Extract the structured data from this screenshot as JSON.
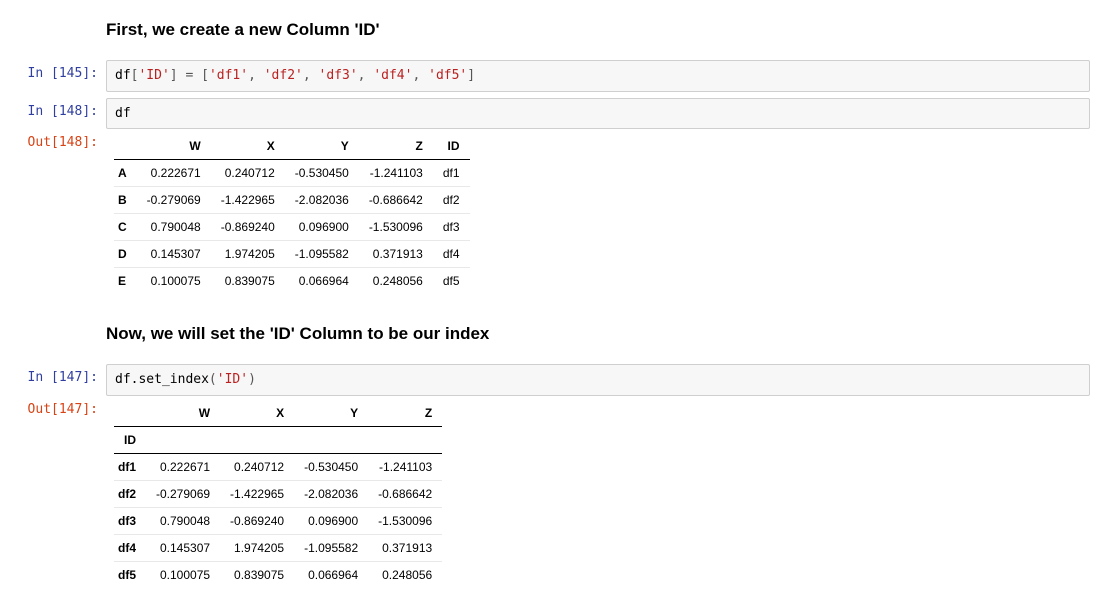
{
  "cells": {
    "md1": {
      "heading": "First, we create a new Column 'ID'"
    },
    "c1": {
      "prompt": "In [145]:",
      "code": [
        {
          "t": "name",
          "v": "df"
        },
        {
          "t": "op",
          "v": "["
        },
        {
          "t": "str",
          "v": "'ID'"
        },
        {
          "t": "op",
          "v": "] = ["
        },
        {
          "t": "str",
          "v": "'df1'"
        },
        {
          "t": "op",
          "v": ", "
        },
        {
          "t": "str",
          "v": "'df2'"
        },
        {
          "t": "op",
          "v": ", "
        },
        {
          "t": "str",
          "v": "'df3'"
        },
        {
          "t": "op",
          "v": ", "
        },
        {
          "t": "str",
          "v": "'df4'"
        },
        {
          "t": "op",
          "v": ", "
        },
        {
          "t": "str",
          "v": "'df5'"
        },
        {
          "t": "op",
          "v": "]"
        }
      ]
    },
    "c2": {
      "prompt": "In [148]:",
      "code": [
        {
          "t": "name",
          "v": "df"
        }
      ],
      "out_prompt": "Out[148]:",
      "df": {
        "index_name": "",
        "columns": [
          "W",
          "X",
          "Y",
          "Z",
          "ID"
        ],
        "index": [
          "A",
          "B",
          "C",
          "D",
          "E"
        ],
        "rows": [
          [
            "0.222671",
            "0.240712",
            "-0.530450",
            "-1.241103",
            "df1"
          ],
          [
            "-0.279069",
            "-1.422965",
            "-2.082036",
            "-0.686642",
            "df2"
          ],
          [
            "0.790048",
            "-0.869240",
            "0.096900",
            "-1.530096",
            "df3"
          ],
          [
            "0.145307",
            "1.974205",
            "-1.095582",
            "0.371913",
            "df4"
          ],
          [
            "0.100075",
            "0.839075",
            "0.066964",
            "0.248056",
            "df5"
          ]
        ]
      }
    },
    "md2": {
      "heading": "Now, we will set the 'ID' Column to be our index"
    },
    "c3": {
      "prompt": "In [147]:",
      "code": [
        {
          "t": "name",
          "v": "df.set_index"
        },
        {
          "t": "op",
          "v": "("
        },
        {
          "t": "str",
          "v": "'ID'"
        },
        {
          "t": "op",
          "v": ")"
        }
      ],
      "out_prompt": "Out[147]:",
      "df": {
        "index_name": "ID",
        "columns": [
          "W",
          "X",
          "Y",
          "Z"
        ],
        "index": [
          "df1",
          "df2",
          "df3",
          "df4",
          "df5"
        ],
        "rows": [
          [
            "0.222671",
            "0.240712",
            "-0.530450",
            "-1.241103"
          ],
          [
            "-0.279069",
            "-1.422965",
            "-2.082036",
            "-0.686642"
          ],
          [
            "0.790048",
            "-0.869240",
            "0.096900",
            "-1.530096"
          ],
          [
            "0.145307",
            "1.974205",
            "-1.095582",
            "0.371913"
          ],
          [
            "0.100075",
            "0.839075",
            "0.066964",
            "0.248056"
          ]
        ]
      }
    }
  }
}
